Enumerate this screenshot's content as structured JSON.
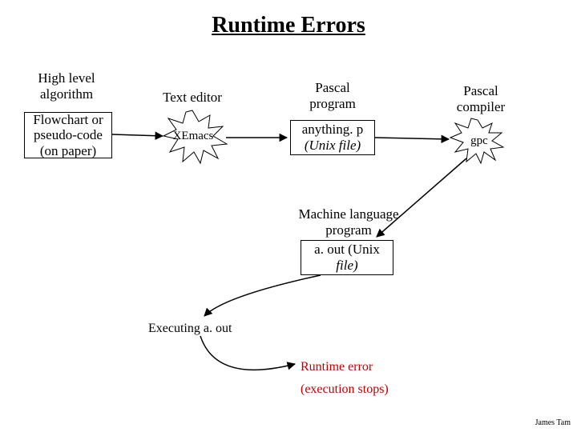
{
  "title": "Runtime Errors",
  "labels": {
    "high_level": "High level\nalgorithm",
    "text_editor": "Text editor",
    "pascal_program": "Pascal\nprogram",
    "pascal_compiler": "Pascal\ncompiler",
    "machine_lang": "Machine language\nprogram",
    "executing": "Executing a. out",
    "runtime_error": "Runtime error",
    "exec_stops": "(execution stops)"
  },
  "boxes": {
    "flowchart": "Flowchart or\npseudo-code\n(on paper)",
    "xemacs": "XEmacs",
    "anything_p": "anything. p\n(Unix file)",
    "gpc": "gpc",
    "aout": "a. out (Unix\nfile)"
  },
  "footer": "James Tam"
}
